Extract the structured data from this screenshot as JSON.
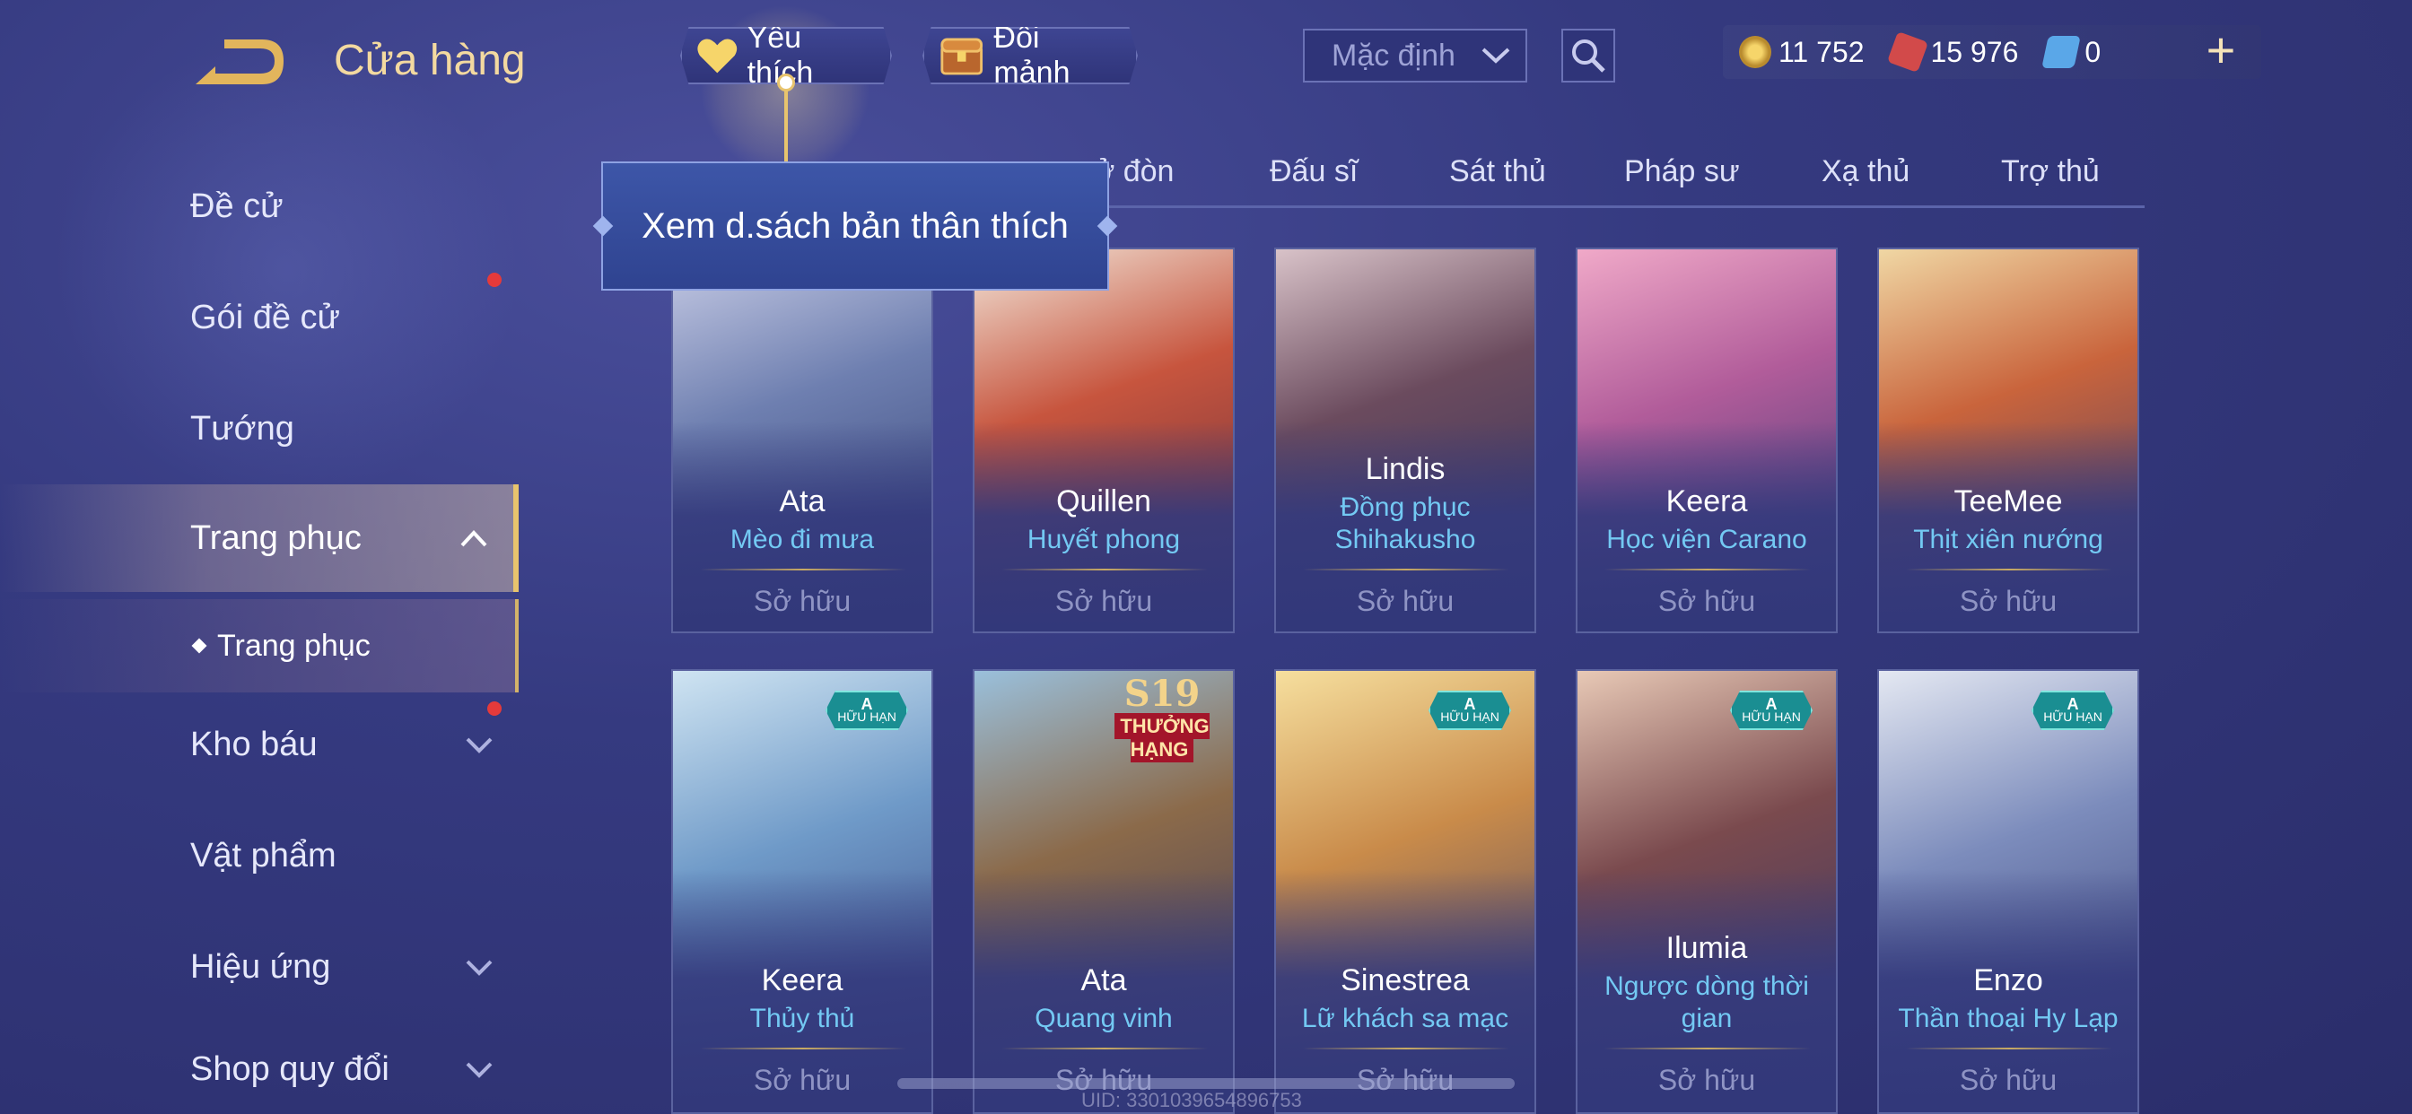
{
  "header": {
    "title": "Cửa hàng",
    "favorite_label": "Yêu thích",
    "shards_label": "Đổi mảnh",
    "sort_value": "Mặc định"
  },
  "currency": {
    "gold": "11 752",
    "vouchers": "15 976",
    "tokens": "0"
  },
  "tooltip": {
    "text": "Xem d.sách bản thân thích"
  },
  "sidebar": {
    "items": [
      {
        "label": "Đề cử"
      },
      {
        "label": "Gói đề cử"
      },
      {
        "label": "Tướng"
      },
      {
        "label": "Trang phục"
      },
      {
        "label": "Kho báu"
      },
      {
        "label": "Vật phẩm"
      },
      {
        "label": "Hiệu ứng"
      },
      {
        "label": "Shop quy đổi"
      }
    ],
    "sub_item": "Trang phục"
  },
  "tabs": [
    "ở đòn",
    "Đấu sĩ",
    "Sát thủ",
    "Pháp sư",
    "Xạ thủ",
    "Trợ thủ"
  ],
  "cards": [
    {
      "hero": "Ata",
      "skin": "Mèo đi mưa",
      "status": "Sở hữu"
    },
    {
      "hero": "Quillen",
      "skin": "Huyết phong",
      "status": "Sở hữu"
    },
    {
      "hero": "Lindis",
      "skin": "Đồng phục Shihakusho",
      "status": "Sở hữu"
    },
    {
      "hero": "Keera",
      "skin": "Học viện Carano",
      "status": "Sở hữu"
    },
    {
      "hero": "TeeMee",
      "skin": "Thịt xiên nướng",
      "status": "Sở hữu"
    },
    {
      "hero": "Keera",
      "skin": "Thủy thủ",
      "status": "Sở hữu",
      "badge": "A HỮU HẠN"
    },
    {
      "hero": "Ata",
      "skin": "Quang vinh",
      "status": "Sở hữu",
      "rank_badge": "S19",
      "rank_text": "THƯỞNG HẠNG"
    },
    {
      "hero": "Sinestrea",
      "skin": "Lữ khách sa mạc",
      "status": "Sở hữu",
      "badge": "A HỮU HẠN"
    },
    {
      "hero": "Ilumia",
      "skin": "Ngược dòng thời gian",
      "status": "Sở hữu",
      "badge": "A HỮU HẠN"
    },
    {
      "hero": "Enzo",
      "skin": "Thần thoại Hy Lạp",
      "status": "Sở hữu",
      "badge": "A HỮU HẠN"
    }
  ],
  "footer": {
    "uid": "UID: 3301039654896753"
  },
  "colors": {
    "accent_gold": "#e8c46d",
    "skin_blue": "#73c9f3",
    "bg": "#353a80"
  }
}
